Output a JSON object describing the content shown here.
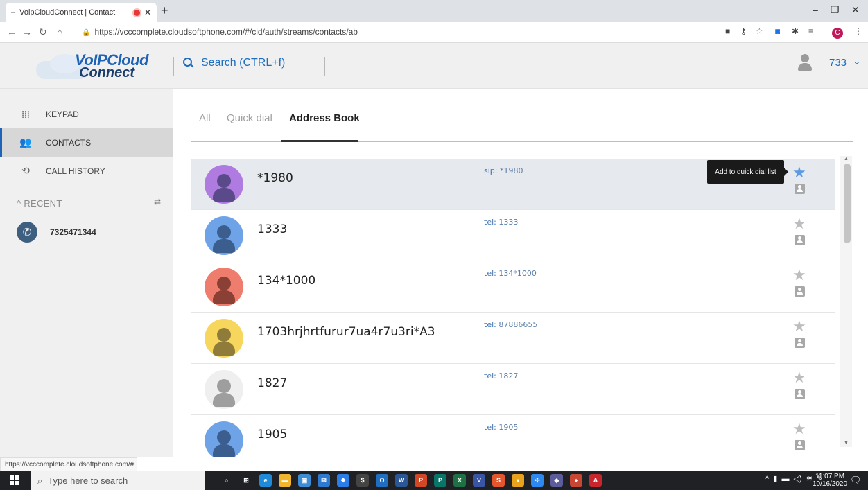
{
  "browser": {
    "tab_title": "VoipCloudConnect | Contact",
    "tab_close": "✕",
    "new_tab": "+",
    "url": "https://vcccomplete.cloudsoftphone.com/#/cid/auth/streams/contacts/ab",
    "profile_initial": "C",
    "status_url": "https://vcccomplete.cloudsoftphone.com/#"
  },
  "header": {
    "logo_line1": "VoIPCloud",
    "logo_line2": "Connect",
    "search_placeholder": "Search (CTRL+f)",
    "user_extension": "733",
    "user_caret": "⌄"
  },
  "sidebar": {
    "items": [
      {
        "label": "KEYPAD",
        "icon": "keypad-icon"
      },
      {
        "label": "CONTACTS",
        "icon": "people-icon"
      },
      {
        "label": "CALL HISTORY",
        "icon": "history-icon"
      }
    ],
    "recent_header": "RECENT",
    "recent_items": [
      {
        "number": "7325471344"
      }
    ]
  },
  "tabs": [
    "All",
    "Quick dial",
    "Address Book"
  ],
  "selected_tab": "Address Book",
  "tooltip": "Add to quick dial list",
  "contacts": [
    {
      "name": "*1980",
      "addr_type": "sip:",
      "addr_value": "*1980",
      "avatar_color": "#b07be0",
      "avatar_fg": "#5a4a8a",
      "highlighted": true
    },
    {
      "name": "1333",
      "addr_type": "tel:",
      "addr_value": "1333",
      "avatar_color": "#6fa3e8",
      "avatar_fg": "#3b5e8e"
    },
    {
      "name": "134*1000",
      "addr_type": "tel:",
      "addr_value": "134*1000",
      "avatar_color": "#ef7d6d",
      "avatar_fg": "#8a4035"
    },
    {
      "name": "1703hrjhrtfurur7ua4r7u3ri*A3",
      "addr_type": "tel:",
      "addr_value": "87886655",
      "avatar_color": "#f6d65c",
      "avatar_fg": "#8f7c3a"
    },
    {
      "name": "1827",
      "addr_type": "tel:",
      "addr_value": "1827",
      "avatar_color": "#efefef",
      "avatar_fg": "#9e9e9e"
    },
    {
      "name": "1905",
      "addr_type": "tel:",
      "addr_value": "1905",
      "avatar_color": "#6fa3e8",
      "avatar_fg": "#3b5e8e"
    }
  ],
  "taskbar": {
    "search_placeholder": "Type here to search",
    "time": "11:07 PM",
    "date": "10/16/2020"
  }
}
